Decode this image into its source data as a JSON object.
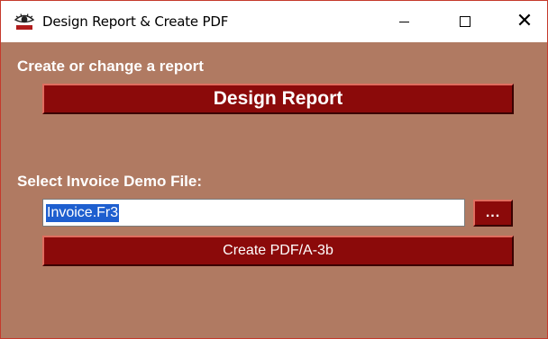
{
  "window": {
    "title": "Design Report & Create PDF",
    "icon": "eye-logo-icon",
    "accent": "#8b0a0a",
    "background": "#b07a62"
  },
  "caption_buttons": {
    "minimize": "—",
    "maximize": "☐",
    "close": "✕"
  },
  "report_section": {
    "label": "Create or change a report",
    "button_label": "Design Report"
  },
  "invoice_section": {
    "label": "Select Invoice Demo File:",
    "file_value": "Invoice.Fr3",
    "browse_label": "...",
    "create_label": "Create PDF/A-3b"
  }
}
